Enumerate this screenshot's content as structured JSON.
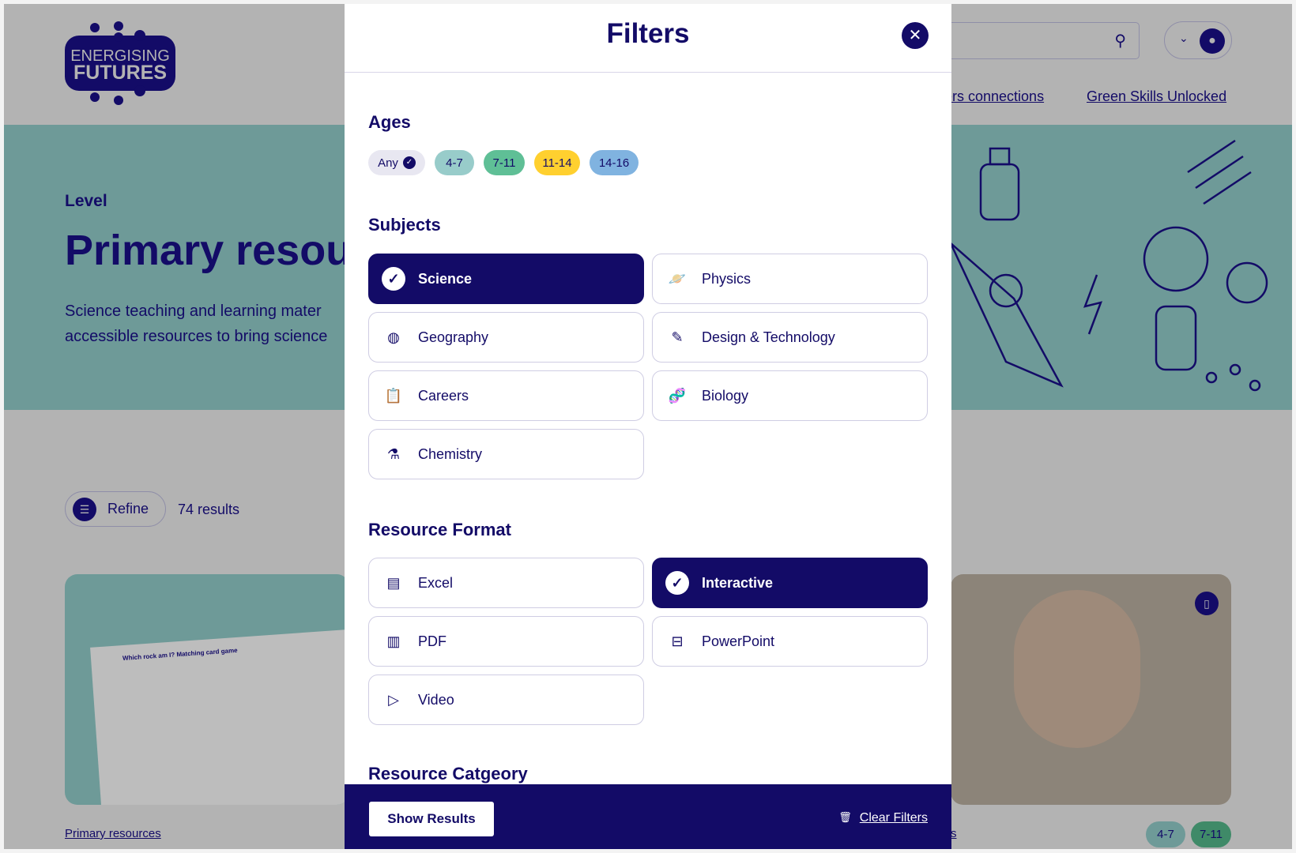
{
  "header": {
    "logo_line1": "ENERGISING",
    "logo_line2": "FUTURES",
    "nav": [
      "ers connections",
      "Green Skills Unlocked"
    ]
  },
  "hero": {
    "eyebrow": "Level",
    "title": "Primary resou",
    "desc1": "Science teaching and learning mater",
    "desc2": "accessible resources to bring science"
  },
  "results": {
    "refine_label": "Refine",
    "count": "74 results"
  },
  "cards": [
    {
      "link": "Primary resources",
      "title1": "Which rock am I? Matching card game"
    },
    {
      "link": "s",
      "ages": [
        "4-7",
        "7-11"
      ]
    }
  ],
  "modal": {
    "title": "Filters",
    "ages": {
      "heading": "Ages",
      "chips": [
        {
          "label": "Any",
          "selected": true,
          "color": "#e8e7f1"
        },
        {
          "label": "4-7",
          "color": "#98ccca"
        },
        {
          "label": "7-11",
          "color": "#5fbf96"
        },
        {
          "label": "11-14",
          "color": "#ffd02f"
        },
        {
          "label": "14-16",
          "color": "#80b3e0"
        }
      ]
    },
    "subjects": {
      "heading": "Subjects",
      "items": [
        {
          "label": "Science",
          "icon": "check-icon",
          "selected": true
        },
        {
          "label": "Physics",
          "icon": "planet-icon"
        },
        {
          "label": "Geography",
          "icon": "globe-icon"
        },
        {
          "label": "Design & Technology",
          "icon": "pencil-gear-icon"
        },
        {
          "label": "Careers",
          "icon": "clipboard-icon"
        },
        {
          "label": "Biology",
          "icon": "dna-icon"
        },
        {
          "label": "Chemistry",
          "icon": "flask-icon"
        }
      ]
    },
    "format": {
      "heading": "Resource Format",
      "items": [
        {
          "label": "Excel",
          "icon": "spreadsheet-file-icon"
        },
        {
          "label": "Interactive",
          "icon": "check-icon",
          "selected": true
        },
        {
          "label": "PDF",
          "icon": "pdf-file-icon"
        },
        {
          "label": "PowerPoint",
          "icon": "presentation-icon"
        },
        {
          "label": "Video",
          "icon": "play-icon"
        }
      ]
    },
    "category": {
      "heading": "Resource Catgeory"
    },
    "footer": {
      "show_results": "Show Results",
      "clear_filters": "Clear Filters"
    }
  },
  "colors": {
    "navy": "#130b67",
    "hero": "#98ccca"
  }
}
